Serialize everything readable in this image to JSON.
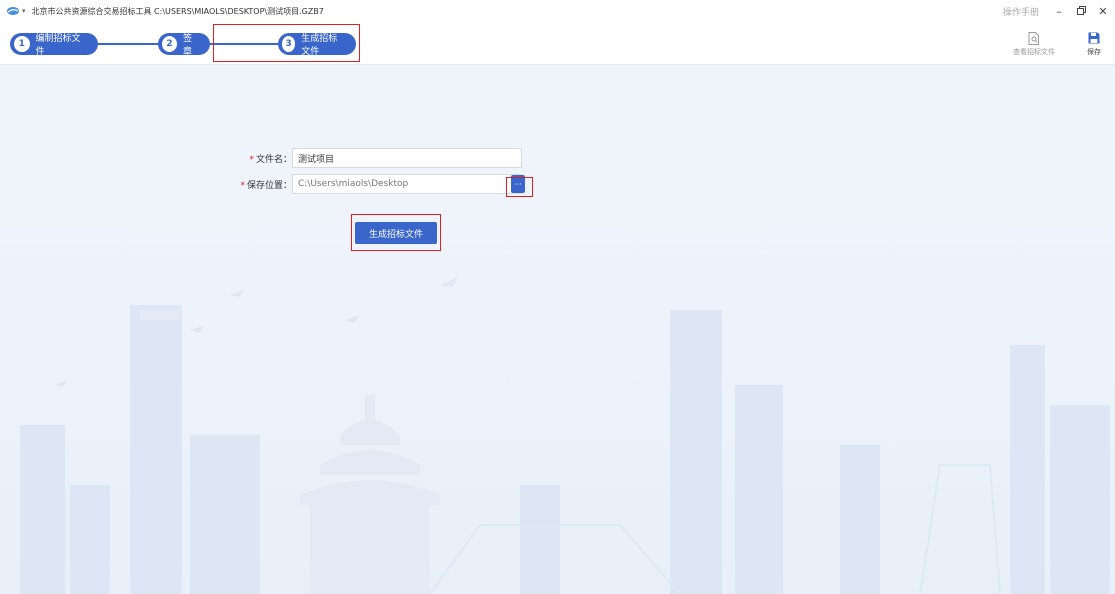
{
  "window": {
    "title": "北京市公共资源综合交易招标工具  C:\\USERS\\MIAOLS\\DESKTOP\\测试项目.GZB7",
    "manual_link": "操作手册",
    "minimize": "–",
    "restore": "🗗",
    "close": "✕"
  },
  "steps": [
    {
      "num": "1",
      "label": "编制招标文件"
    },
    {
      "num": "2",
      "label": "签章"
    },
    {
      "num": "3",
      "label": "生成招标文件"
    }
  ],
  "toolbar": {
    "view_label": "查看招标文件",
    "save_label": "保存"
  },
  "form": {
    "required_mark": "*",
    "filename_label": "文件名：",
    "filename_value": "测试项目",
    "location_label": "保存位置：",
    "location_value": "C:\\Users\\miaols\\Desktop",
    "browse_label": "···",
    "generate_label": "生成招标文件"
  },
  "colors": {
    "accent": "#3a66cc",
    "highlight": "#e02020"
  }
}
